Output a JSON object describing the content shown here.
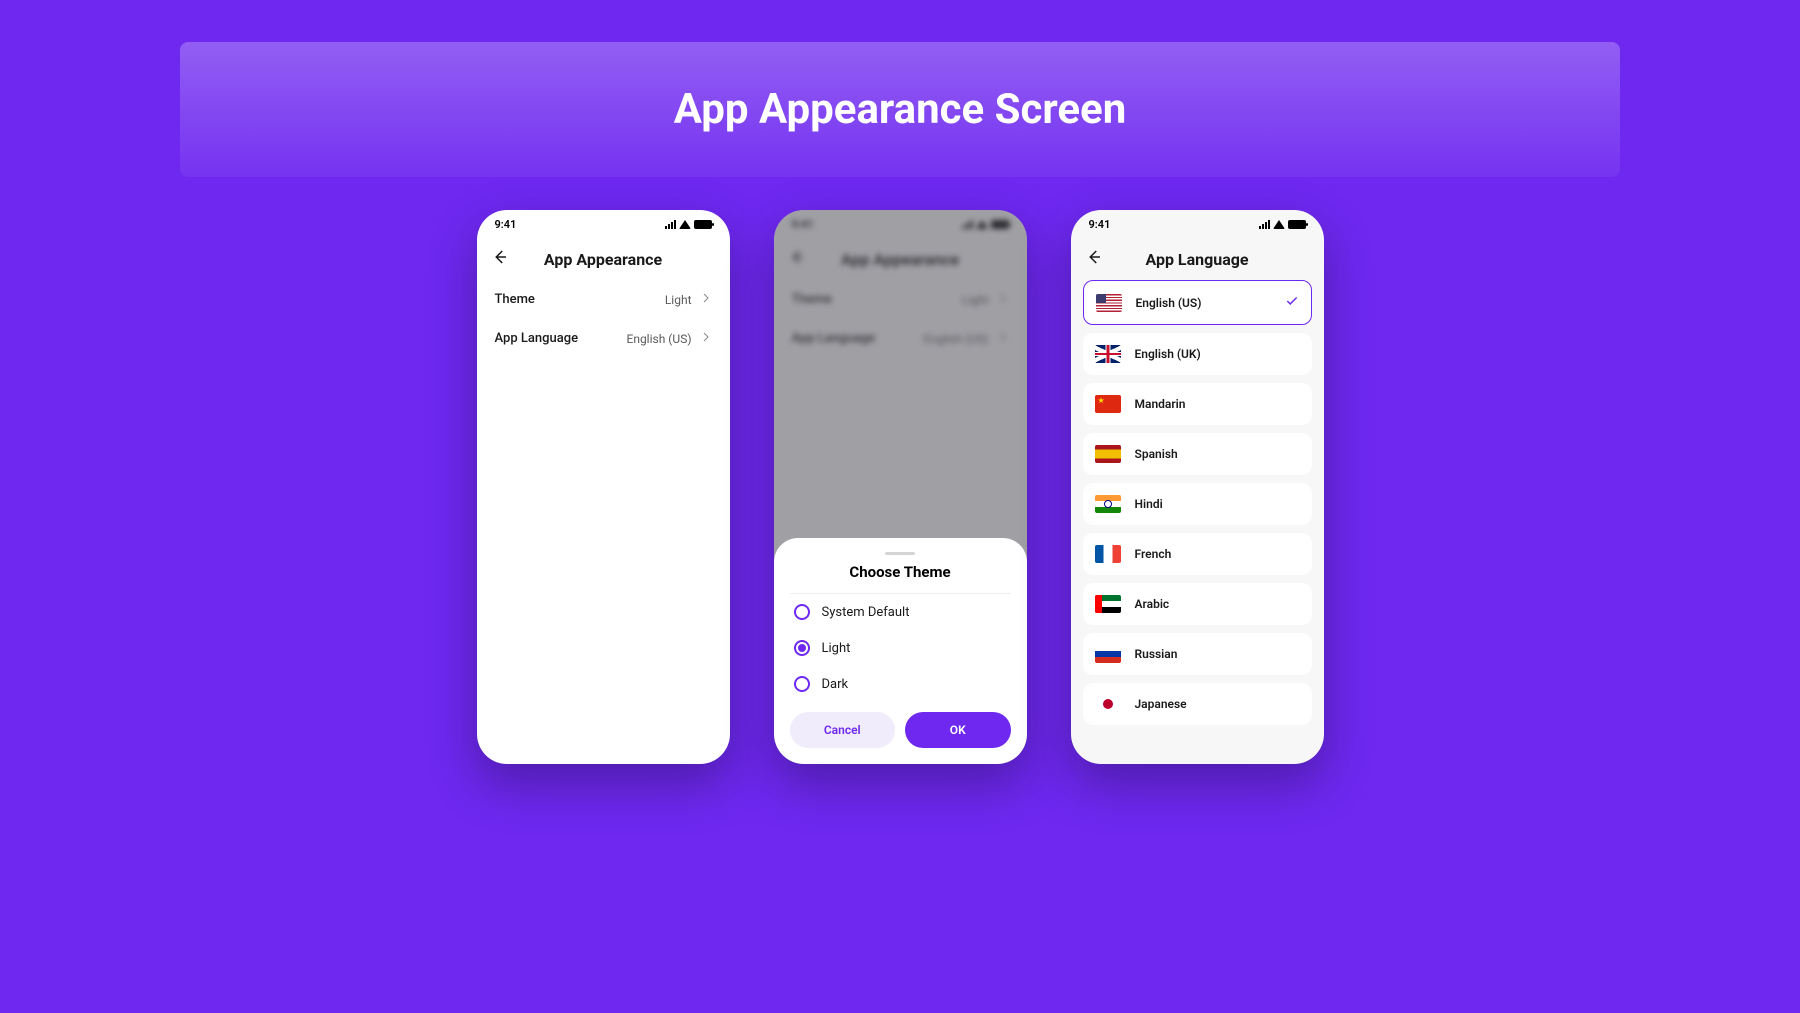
{
  "colors": {
    "accent": "#6e28f0"
  },
  "banner_title": "App Appearance Screen",
  "status_time": "9:41",
  "screen1": {
    "title": "App Appearance",
    "rows": [
      {
        "label": "Theme",
        "value": "Light"
      },
      {
        "label": "App Language",
        "value": "English (US)"
      }
    ]
  },
  "screen2": {
    "bg_title": "App Appearance",
    "bg_rows": [
      {
        "label": "Theme",
        "value": "Light"
      },
      {
        "label": "App Language",
        "value": "English (US)"
      }
    ],
    "sheet_title": "Choose Theme",
    "options": [
      {
        "label": "System Default",
        "selected": false
      },
      {
        "label": "Light",
        "selected": true
      },
      {
        "label": "Dark",
        "selected": false
      }
    ],
    "cancel_label": "Cancel",
    "ok_label": "OK"
  },
  "screen3": {
    "title": "App Language",
    "languages": [
      {
        "label": "English (US)",
        "flag": "us",
        "selected": true
      },
      {
        "label": "English (UK)",
        "flag": "uk",
        "selected": false
      },
      {
        "label": "Mandarin",
        "flag": "cn",
        "selected": false
      },
      {
        "label": "Spanish",
        "flag": "es",
        "selected": false
      },
      {
        "label": "Hindi",
        "flag": "in",
        "selected": false
      },
      {
        "label": "French",
        "flag": "fr",
        "selected": false
      },
      {
        "label": "Arabic",
        "flag": "ae",
        "selected": false
      },
      {
        "label": "Russian",
        "flag": "ru",
        "selected": false
      },
      {
        "label": "Japanese",
        "flag": "jp",
        "selected": false
      }
    ]
  }
}
